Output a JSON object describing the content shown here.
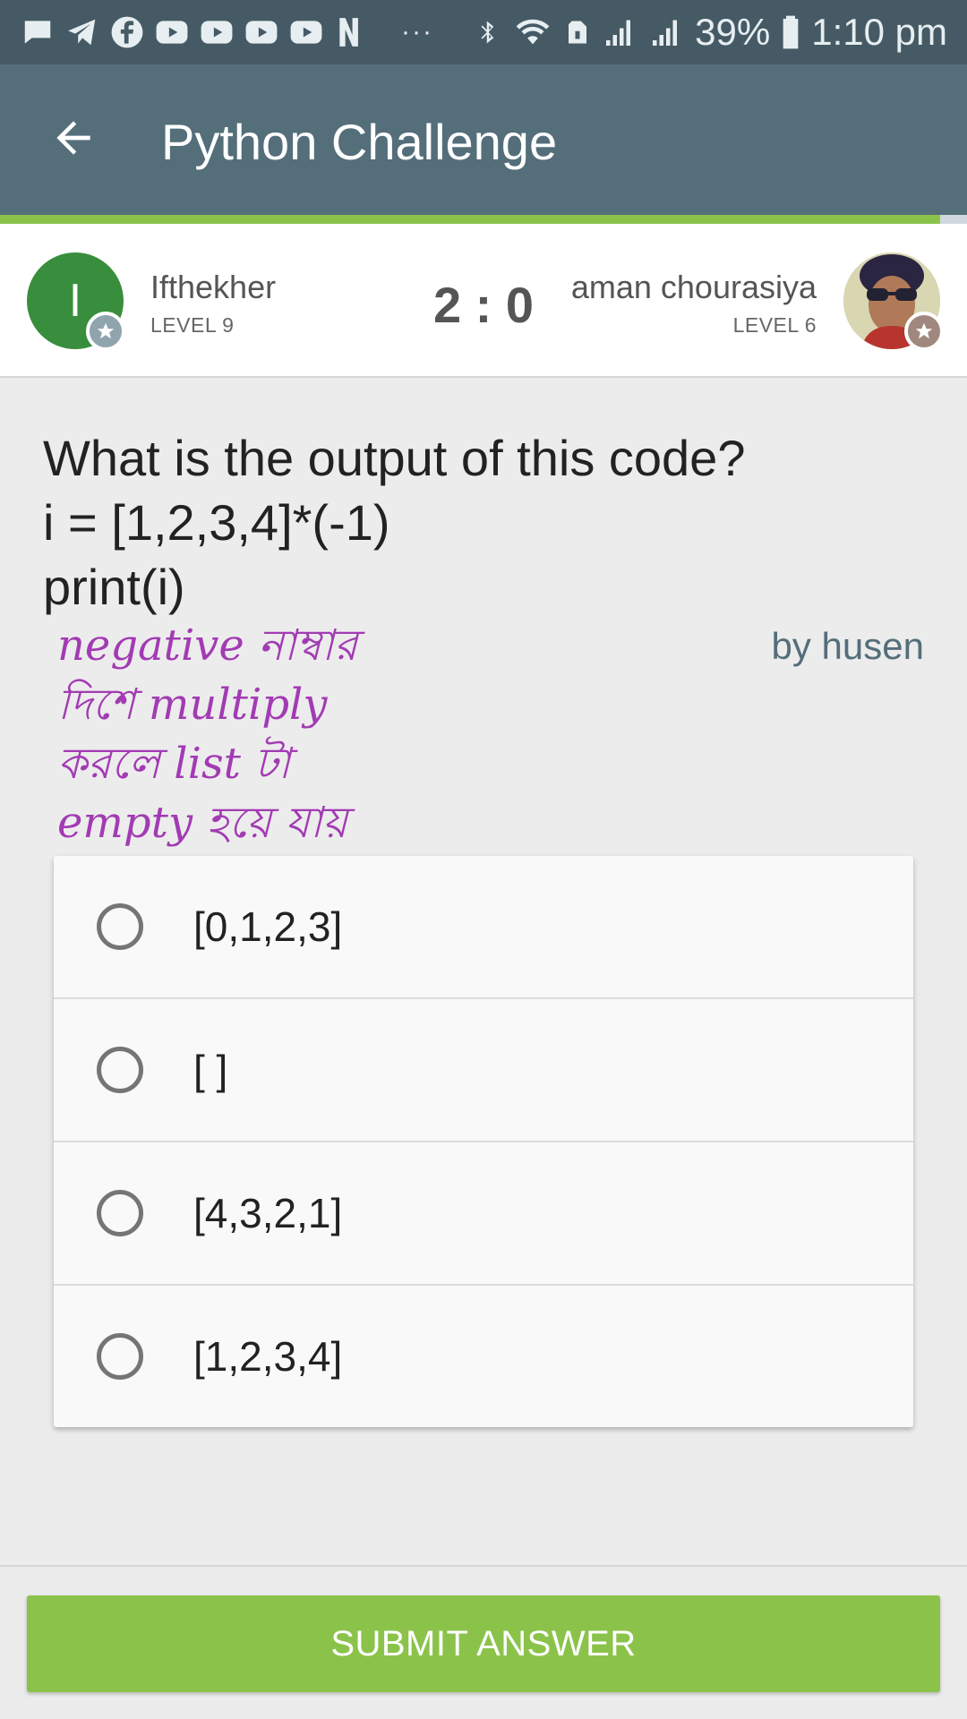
{
  "status_bar": {
    "icons": [
      "message-icon",
      "telegram-icon",
      "facebook-icon",
      "youtube-icon",
      "youtube-icon",
      "youtube-icon",
      "youtube-icon",
      "netflix-icon"
    ],
    "more": "···",
    "battery": "39%",
    "time": "1:10 pm"
  },
  "app_bar": {
    "title": "Python Challenge"
  },
  "players": {
    "left": {
      "initial": "I",
      "name": "Ifthekher",
      "level": "LEVEL 9"
    },
    "score": "2 : 0",
    "right": {
      "name": "aman chourasiya",
      "level": "LEVEL 6"
    }
  },
  "question": {
    "lines": [
      "What is the output of this code?",
      "i = [1,2,3,4]*(-1)",
      "print(i)"
    ],
    "author": "by husen"
  },
  "annotation": {
    "lines": [
      "negative নাম্বার",
      "দিশে multiply",
      "করলে list টা",
      "empty হয়ে যায়"
    ]
  },
  "options": [
    {
      "label": "[0,1,2,3]"
    },
    {
      "label": "[ ]"
    },
    {
      "label": "[4,3,2,1]"
    },
    {
      "label": "[1,2,3,4]"
    }
  ],
  "submit": {
    "label": "SUBMIT ANSWER"
  },
  "colors": {
    "status_bar": "#455a64",
    "app_bar": "#546e7a",
    "accent_green": "#8bc34a",
    "annotation_purple": "#a23bb3"
  }
}
